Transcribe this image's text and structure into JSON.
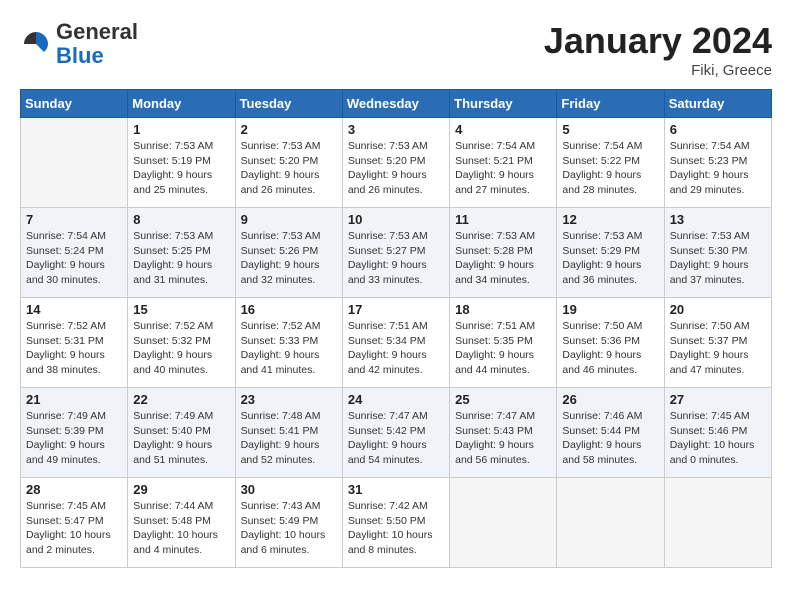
{
  "header": {
    "logo_general": "General",
    "logo_blue": "Blue",
    "month_title": "January 2024",
    "location": "Fiki, Greece"
  },
  "weekdays": [
    "Sunday",
    "Monday",
    "Tuesday",
    "Wednesday",
    "Thursday",
    "Friday",
    "Saturday"
  ],
  "weeks": [
    [
      {
        "day": "",
        "sunrise": "",
        "sunset": "",
        "daylight": "",
        "empty": true
      },
      {
        "day": "1",
        "sunrise": "Sunrise: 7:53 AM",
        "sunset": "Sunset: 5:19 PM",
        "daylight": "Daylight: 9 hours and 25 minutes."
      },
      {
        "day": "2",
        "sunrise": "Sunrise: 7:53 AM",
        "sunset": "Sunset: 5:20 PM",
        "daylight": "Daylight: 9 hours and 26 minutes."
      },
      {
        "day": "3",
        "sunrise": "Sunrise: 7:53 AM",
        "sunset": "Sunset: 5:20 PM",
        "daylight": "Daylight: 9 hours and 26 minutes."
      },
      {
        "day": "4",
        "sunrise": "Sunrise: 7:54 AM",
        "sunset": "Sunset: 5:21 PM",
        "daylight": "Daylight: 9 hours and 27 minutes."
      },
      {
        "day": "5",
        "sunrise": "Sunrise: 7:54 AM",
        "sunset": "Sunset: 5:22 PM",
        "daylight": "Daylight: 9 hours and 28 minutes."
      },
      {
        "day": "6",
        "sunrise": "Sunrise: 7:54 AM",
        "sunset": "Sunset: 5:23 PM",
        "daylight": "Daylight: 9 hours and 29 minutes."
      }
    ],
    [
      {
        "day": "7",
        "sunrise": "Sunrise: 7:54 AM",
        "sunset": "Sunset: 5:24 PM",
        "daylight": "Daylight: 9 hours and 30 minutes."
      },
      {
        "day": "8",
        "sunrise": "Sunrise: 7:53 AM",
        "sunset": "Sunset: 5:25 PM",
        "daylight": "Daylight: 9 hours and 31 minutes."
      },
      {
        "day": "9",
        "sunrise": "Sunrise: 7:53 AM",
        "sunset": "Sunset: 5:26 PM",
        "daylight": "Daylight: 9 hours and 32 minutes."
      },
      {
        "day": "10",
        "sunrise": "Sunrise: 7:53 AM",
        "sunset": "Sunset: 5:27 PM",
        "daylight": "Daylight: 9 hours and 33 minutes."
      },
      {
        "day": "11",
        "sunrise": "Sunrise: 7:53 AM",
        "sunset": "Sunset: 5:28 PM",
        "daylight": "Daylight: 9 hours and 34 minutes."
      },
      {
        "day": "12",
        "sunrise": "Sunrise: 7:53 AM",
        "sunset": "Sunset: 5:29 PM",
        "daylight": "Daylight: 9 hours and 36 minutes."
      },
      {
        "day": "13",
        "sunrise": "Sunrise: 7:53 AM",
        "sunset": "Sunset: 5:30 PM",
        "daylight": "Daylight: 9 hours and 37 minutes."
      }
    ],
    [
      {
        "day": "14",
        "sunrise": "Sunrise: 7:52 AM",
        "sunset": "Sunset: 5:31 PM",
        "daylight": "Daylight: 9 hours and 38 minutes."
      },
      {
        "day": "15",
        "sunrise": "Sunrise: 7:52 AM",
        "sunset": "Sunset: 5:32 PM",
        "daylight": "Daylight: 9 hours and 40 minutes."
      },
      {
        "day": "16",
        "sunrise": "Sunrise: 7:52 AM",
        "sunset": "Sunset: 5:33 PM",
        "daylight": "Daylight: 9 hours and 41 minutes."
      },
      {
        "day": "17",
        "sunrise": "Sunrise: 7:51 AM",
        "sunset": "Sunset: 5:34 PM",
        "daylight": "Daylight: 9 hours and 42 minutes."
      },
      {
        "day": "18",
        "sunrise": "Sunrise: 7:51 AM",
        "sunset": "Sunset: 5:35 PM",
        "daylight": "Daylight: 9 hours and 44 minutes."
      },
      {
        "day": "19",
        "sunrise": "Sunrise: 7:50 AM",
        "sunset": "Sunset: 5:36 PM",
        "daylight": "Daylight: 9 hours and 46 minutes."
      },
      {
        "day": "20",
        "sunrise": "Sunrise: 7:50 AM",
        "sunset": "Sunset: 5:37 PM",
        "daylight": "Daylight: 9 hours and 47 minutes."
      }
    ],
    [
      {
        "day": "21",
        "sunrise": "Sunrise: 7:49 AM",
        "sunset": "Sunset: 5:39 PM",
        "daylight": "Daylight: 9 hours and 49 minutes."
      },
      {
        "day": "22",
        "sunrise": "Sunrise: 7:49 AM",
        "sunset": "Sunset: 5:40 PM",
        "daylight": "Daylight: 9 hours and 51 minutes."
      },
      {
        "day": "23",
        "sunrise": "Sunrise: 7:48 AM",
        "sunset": "Sunset: 5:41 PM",
        "daylight": "Daylight: 9 hours and 52 minutes."
      },
      {
        "day": "24",
        "sunrise": "Sunrise: 7:47 AM",
        "sunset": "Sunset: 5:42 PM",
        "daylight": "Daylight: 9 hours and 54 minutes."
      },
      {
        "day": "25",
        "sunrise": "Sunrise: 7:47 AM",
        "sunset": "Sunset: 5:43 PM",
        "daylight": "Daylight: 9 hours and 56 minutes."
      },
      {
        "day": "26",
        "sunrise": "Sunrise: 7:46 AM",
        "sunset": "Sunset: 5:44 PM",
        "daylight": "Daylight: 9 hours and 58 minutes."
      },
      {
        "day": "27",
        "sunrise": "Sunrise: 7:45 AM",
        "sunset": "Sunset: 5:46 PM",
        "daylight": "Daylight: 10 hours and 0 minutes."
      }
    ],
    [
      {
        "day": "28",
        "sunrise": "Sunrise: 7:45 AM",
        "sunset": "Sunset: 5:47 PM",
        "daylight": "Daylight: 10 hours and 2 minutes."
      },
      {
        "day": "29",
        "sunrise": "Sunrise: 7:44 AM",
        "sunset": "Sunset: 5:48 PM",
        "daylight": "Daylight: 10 hours and 4 minutes."
      },
      {
        "day": "30",
        "sunrise": "Sunrise: 7:43 AM",
        "sunset": "Sunset: 5:49 PM",
        "daylight": "Daylight: 10 hours and 6 minutes."
      },
      {
        "day": "31",
        "sunrise": "Sunrise: 7:42 AM",
        "sunset": "Sunset: 5:50 PM",
        "daylight": "Daylight: 10 hours and 8 minutes."
      },
      {
        "day": "",
        "sunrise": "",
        "sunset": "",
        "daylight": "",
        "empty": true
      },
      {
        "day": "",
        "sunrise": "",
        "sunset": "",
        "daylight": "",
        "empty": true
      },
      {
        "day": "",
        "sunrise": "",
        "sunset": "",
        "daylight": "",
        "empty": true
      }
    ]
  ]
}
